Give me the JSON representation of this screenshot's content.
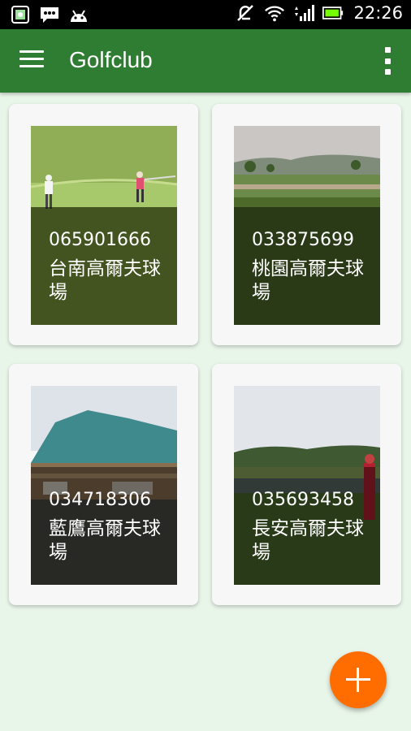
{
  "status_bar": {
    "time": "22:26",
    "left_icons": [
      "screenshot-icon",
      "chat-icon",
      "android-icon"
    ],
    "right_icons": [
      "mute-icon",
      "wifi-icon",
      "signal-icon",
      "battery-icon"
    ]
  },
  "app_bar": {
    "title": "Golfclub",
    "nav_icon": "menu-icon",
    "action_icon": "overflow-menu-icon"
  },
  "cards": [
    {
      "phone": "065901666",
      "name": "台南高爾夫球場"
    },
    {
      "phone": "033875699",
      "name": "桃園高爾夫球場"
    },
    {
      "phone": "034718306",
      "name": "藍鷹高爾夫球場"
    },
    {
      "phone": "035693458",
      "name": "長安高爾夫球場"
    }
  ],
  "fab": {
    "icon": "add-icon"
  },
  "colors": {
    "app_bar": "#2e7d32",
    "background": "#e8f5e9",
    "fab": "#ff6d00",
    "card": "#f7f7f7"
  }
}
